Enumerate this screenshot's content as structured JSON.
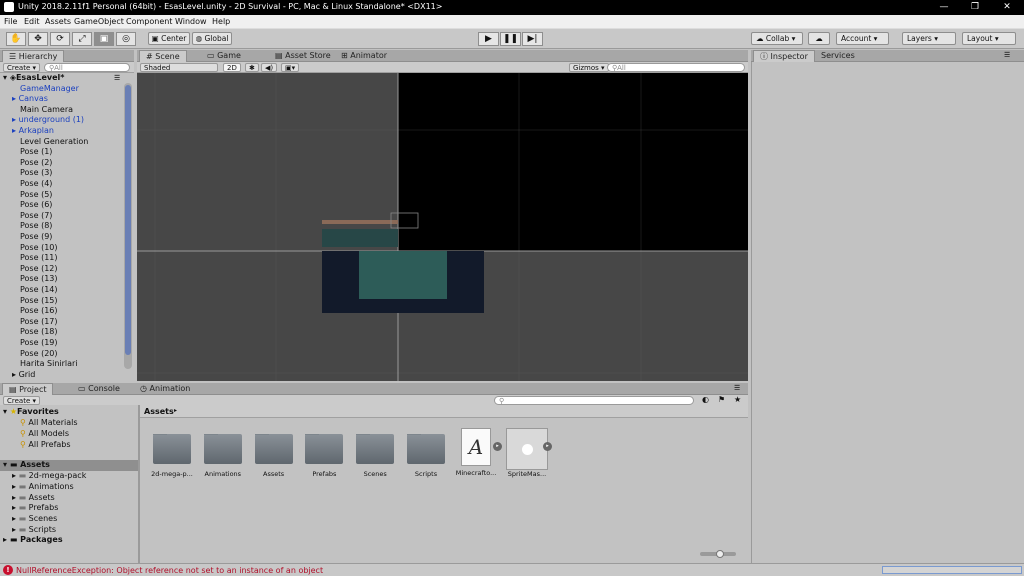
{
  "window": {
    "title": "Unity 2018.2.11f1 Personal (64bit) - EsasLevel.unity - 2D Survival - PC, Mac & Linux Standalone* <DX11>",
    "minimize": "—",
    "maximize": "❐",
    "close": "✕"
  },
  "menu": [
    "File",
    "Edit",
    "Assets",
    "GameObject",
    "Component",
    "Window",
    "Help"
  ],
  "toolbar": {
    "pivot": "Center",
    "space": "Global",
    "collab": "Collab ▾",
    "account": "Account",
    "layers": "Layers",
    "layout": "Layout"
  },
  "hierarchy": {
    "tab": "Hierarchy",
    "create": "Create ▾",
    "search_placeholder": "All",
    "scene": "EsasLevel*",
    "items": [
      "GameManager",
      "Canvas",
      "Main Camera",
      "underground (1)",
      "Arkaplan",
      "Level Generation",
      "Pose (1)",
      "Pose (2)",
      "Pose (3)",
      "Pose (4)",
      "Pose (5)",
      "Pose (6)",
      "Pose (7)",
      "Pose (8)",
      "Pose (9)",
      "Pose (10)",
      "Pose (11)",
      "Pose (12)",
      "Pose (13)",
      "Pose (14)",
      "Pose (15)",
      "Pose (16)",
      "Pose (17)",
      "Pose (18)",
      "Pose (19)",
      "Pose (20)",
      "Harita Sinirlari",
      "Grid"
    ]
  },
  "scene": {
    "tabs": [
      "Scene",
      "Game",
      "Asset Store",
      "Animator"
    ],
    "shading": "Shaded",
    "mode_2d": "2D",
    "gizmos": "Gizmos ▾",
    "search_placeholder": "All"
  },
  "inspector": {
    "tabs": [
      "Inspector",
      "Services"
    ]
  },
  "project": {
    "tabs": [
      "Project",
      "Console",
      "Animation"
    ],
    "create": "Create ▾",
    "favorites": "Favorites",
    "fav_items": [
      "All Materials",
      "All Models",
      "All Prefabs"
    ],
    "assets_root": "Assets",
    "folders": [
      "2d-mega-pack",
      "Animations",
      "Assets",
      "Prefabs",
      "Scenes",
      "Scripts"
    ],
    "packages": "Packages",
    "breadcrumb": "Assets",
    "grid_items": [
      "2d-mega-p...",
      "Animations",
      "Assets",
      "Prefabs",
      "Scenes",
      "Scripts",
      "Minecrafto...",
      "SpriteMas..."
    ],
    "font_glyph": "A"
  },
  "status": {
    "error": "NullReferenceException: Object reference not set to an instance of an object"
  },
  "colors": {
    "error": "#c8102e",
    "selection": "#8f8f8f",
    "scene_bg": "#474747",
    "camera_bg": "#000000"
  }
}
